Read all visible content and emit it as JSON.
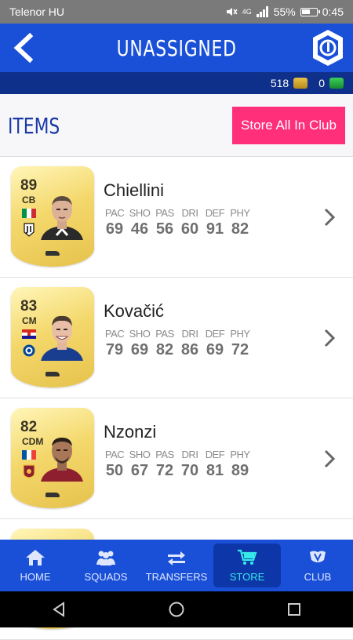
{
  "status_bar": {
    "carrier": "Telenor HU",
    "battery": "55%",
    "time": "0:45",
    "network": "4G"
  },
  "header": {
    "title": "UNASSIGNED"
  },
  "currency": {
    "coins": "518",
    "points": "0"
  },
  "items": {
    "title": "ITEMS",
    "store_all_label": "Store All In Club"
  },
  "stat_labels": [
    "PAC",
    "SHO",
    "PAS",
    "DRI",
    "DEF",
    "PHY"
  ],
  "players": [
    {
      "name": "Chiellini",
      "rating": "89",
      "position": "CB",
      "nation": "Italy",
      "club": "Juventus",
      "stats": [
        "69",
        "46",
        "56",
        "60",
        "91",
        "82"
      ]
    },
    {
      "name": "Kovačić",
      "rating": "83",
      "position": "CM",
      "nation": "Croatia",
      "club": "Chelsea",
      "stats": [
        "79",
        "69",
        "82",
        "86",
        "69",
        "72"
      ]
    },
    {
      "name": "Nzonzi",
      "rating": "82",
      "position": "CDM",
      "nation": "France",
      "club": "Roma",
      "stats": [
        "50",
        "67",
        "72",
        "70",
        "81",
        "89"
      ]
    }
  ],
  "nav": [
    {
      "label": "HOME",
      "icon": "home-icon",
      "active": false
    },
    {
      "label": "SQUADS",
      "icon": "squads-icon",
      "active": false
    },
    {
      "label": "TRANSFERS",
      "icon": "transfers-icon",
      "active": false
    },
    {
      "label": "STORE",
      "icon": "cart-icon",
      "active": true
    },
    {
      "label": "CLUB",
      "icon": "club-icon",
      "active": false
    }
  ],
  "colors": {
    "primary": "#1a50d8",
    "dark_primary": "#0e2f8a",
    "accent": "#ff2f7a",
    "active_nav": "#37e8e8"
  }
}
